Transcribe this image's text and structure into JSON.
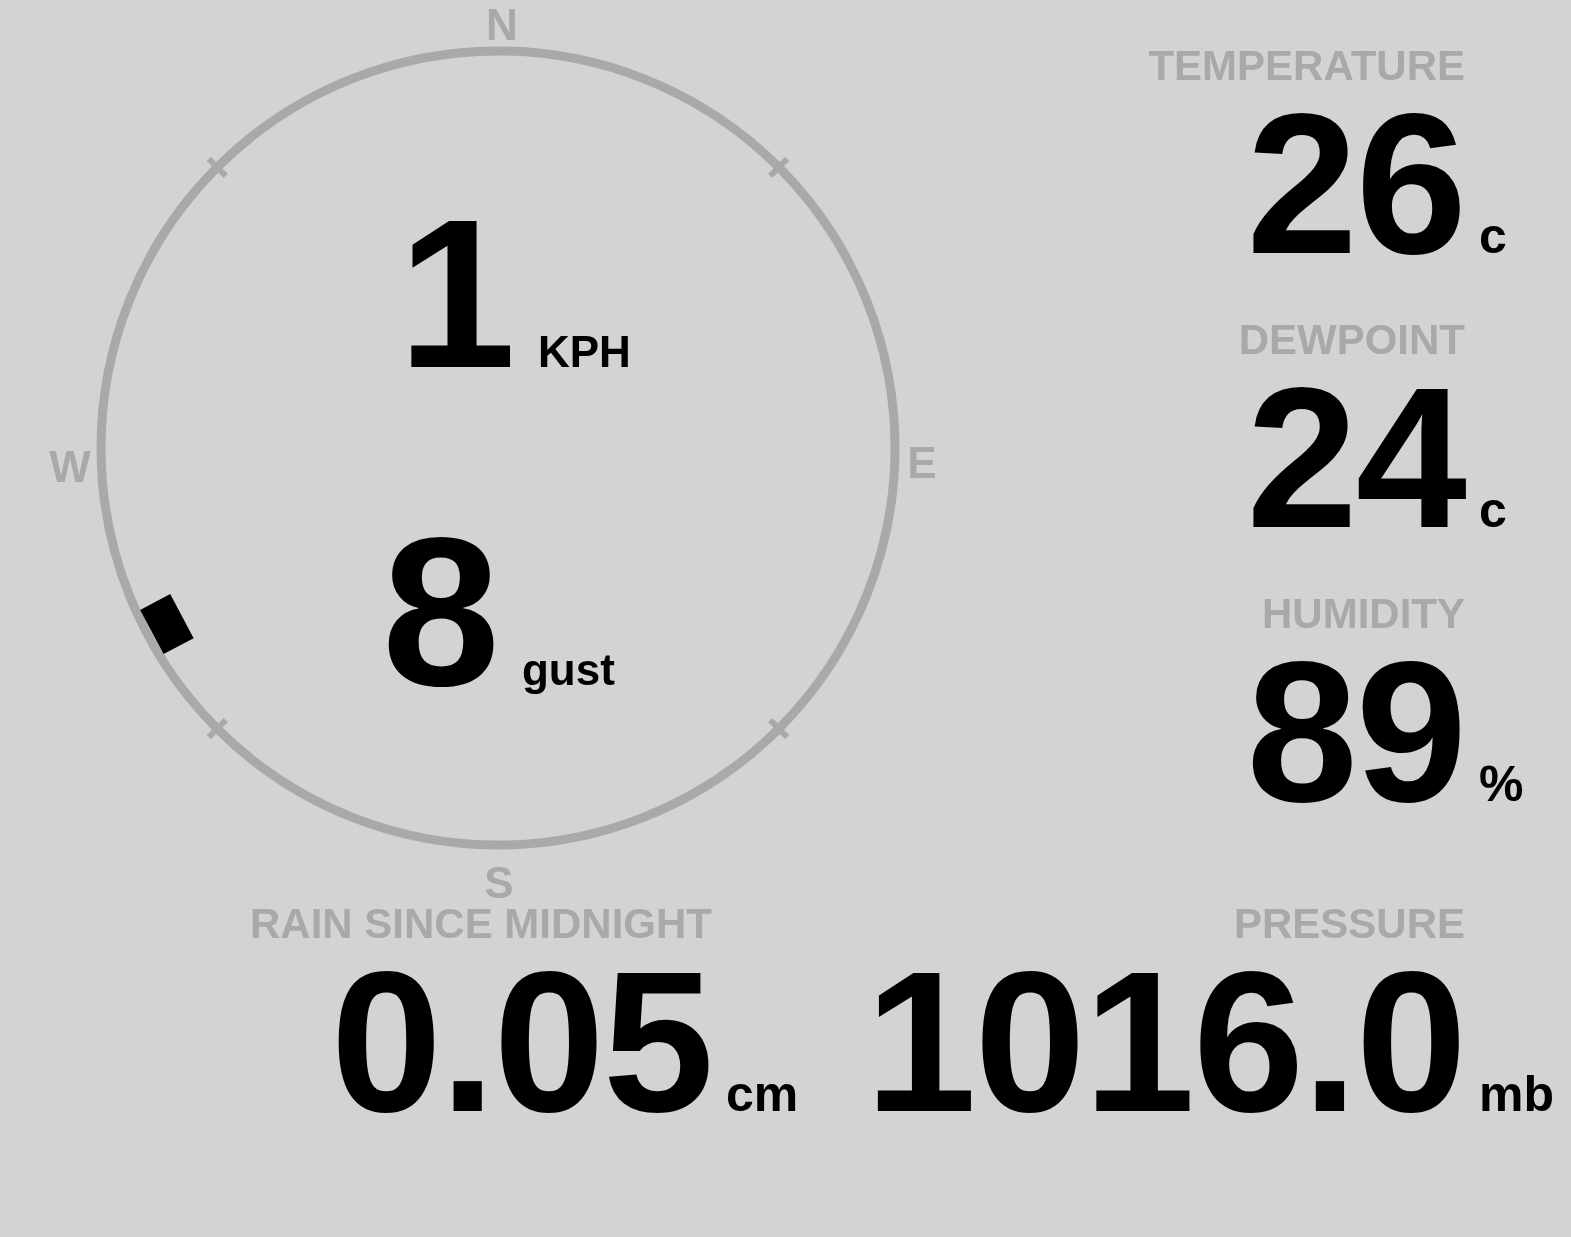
{
  "compass": {
    "directions": [
      {
        "label": "N"
      },
      {
        "label": "E"
      },
      {
        "label": "S"
      },
      {
        "label": "W"
      }
    ],
    "speed": {
      "value": "1",
      "unit": "KPH"
    },
    "gust": {
      "value": "8",
      "unit": "gust"
    }
  },
  "stats": [
    {
      "label": "TEMPERATURE",
      "value": "26",
      "unit": "c"
    },
    {
      "label": "DEWPOINT",
      "value": "24",
      "unit": "c"
    },
    {
      "label": "HUMIDITY",
      "value": "89",
      "unit": "%"
    }
  ],
  "rain": {
    "label": "RAIN SINCE MIDNIGHT",
    "value": "0.05",
    "unit": "cm"
  },
  "pressure": {
    "label": "PRESSURE",
    "value": "1016.0",
    "unit": "mb"
  }
}
